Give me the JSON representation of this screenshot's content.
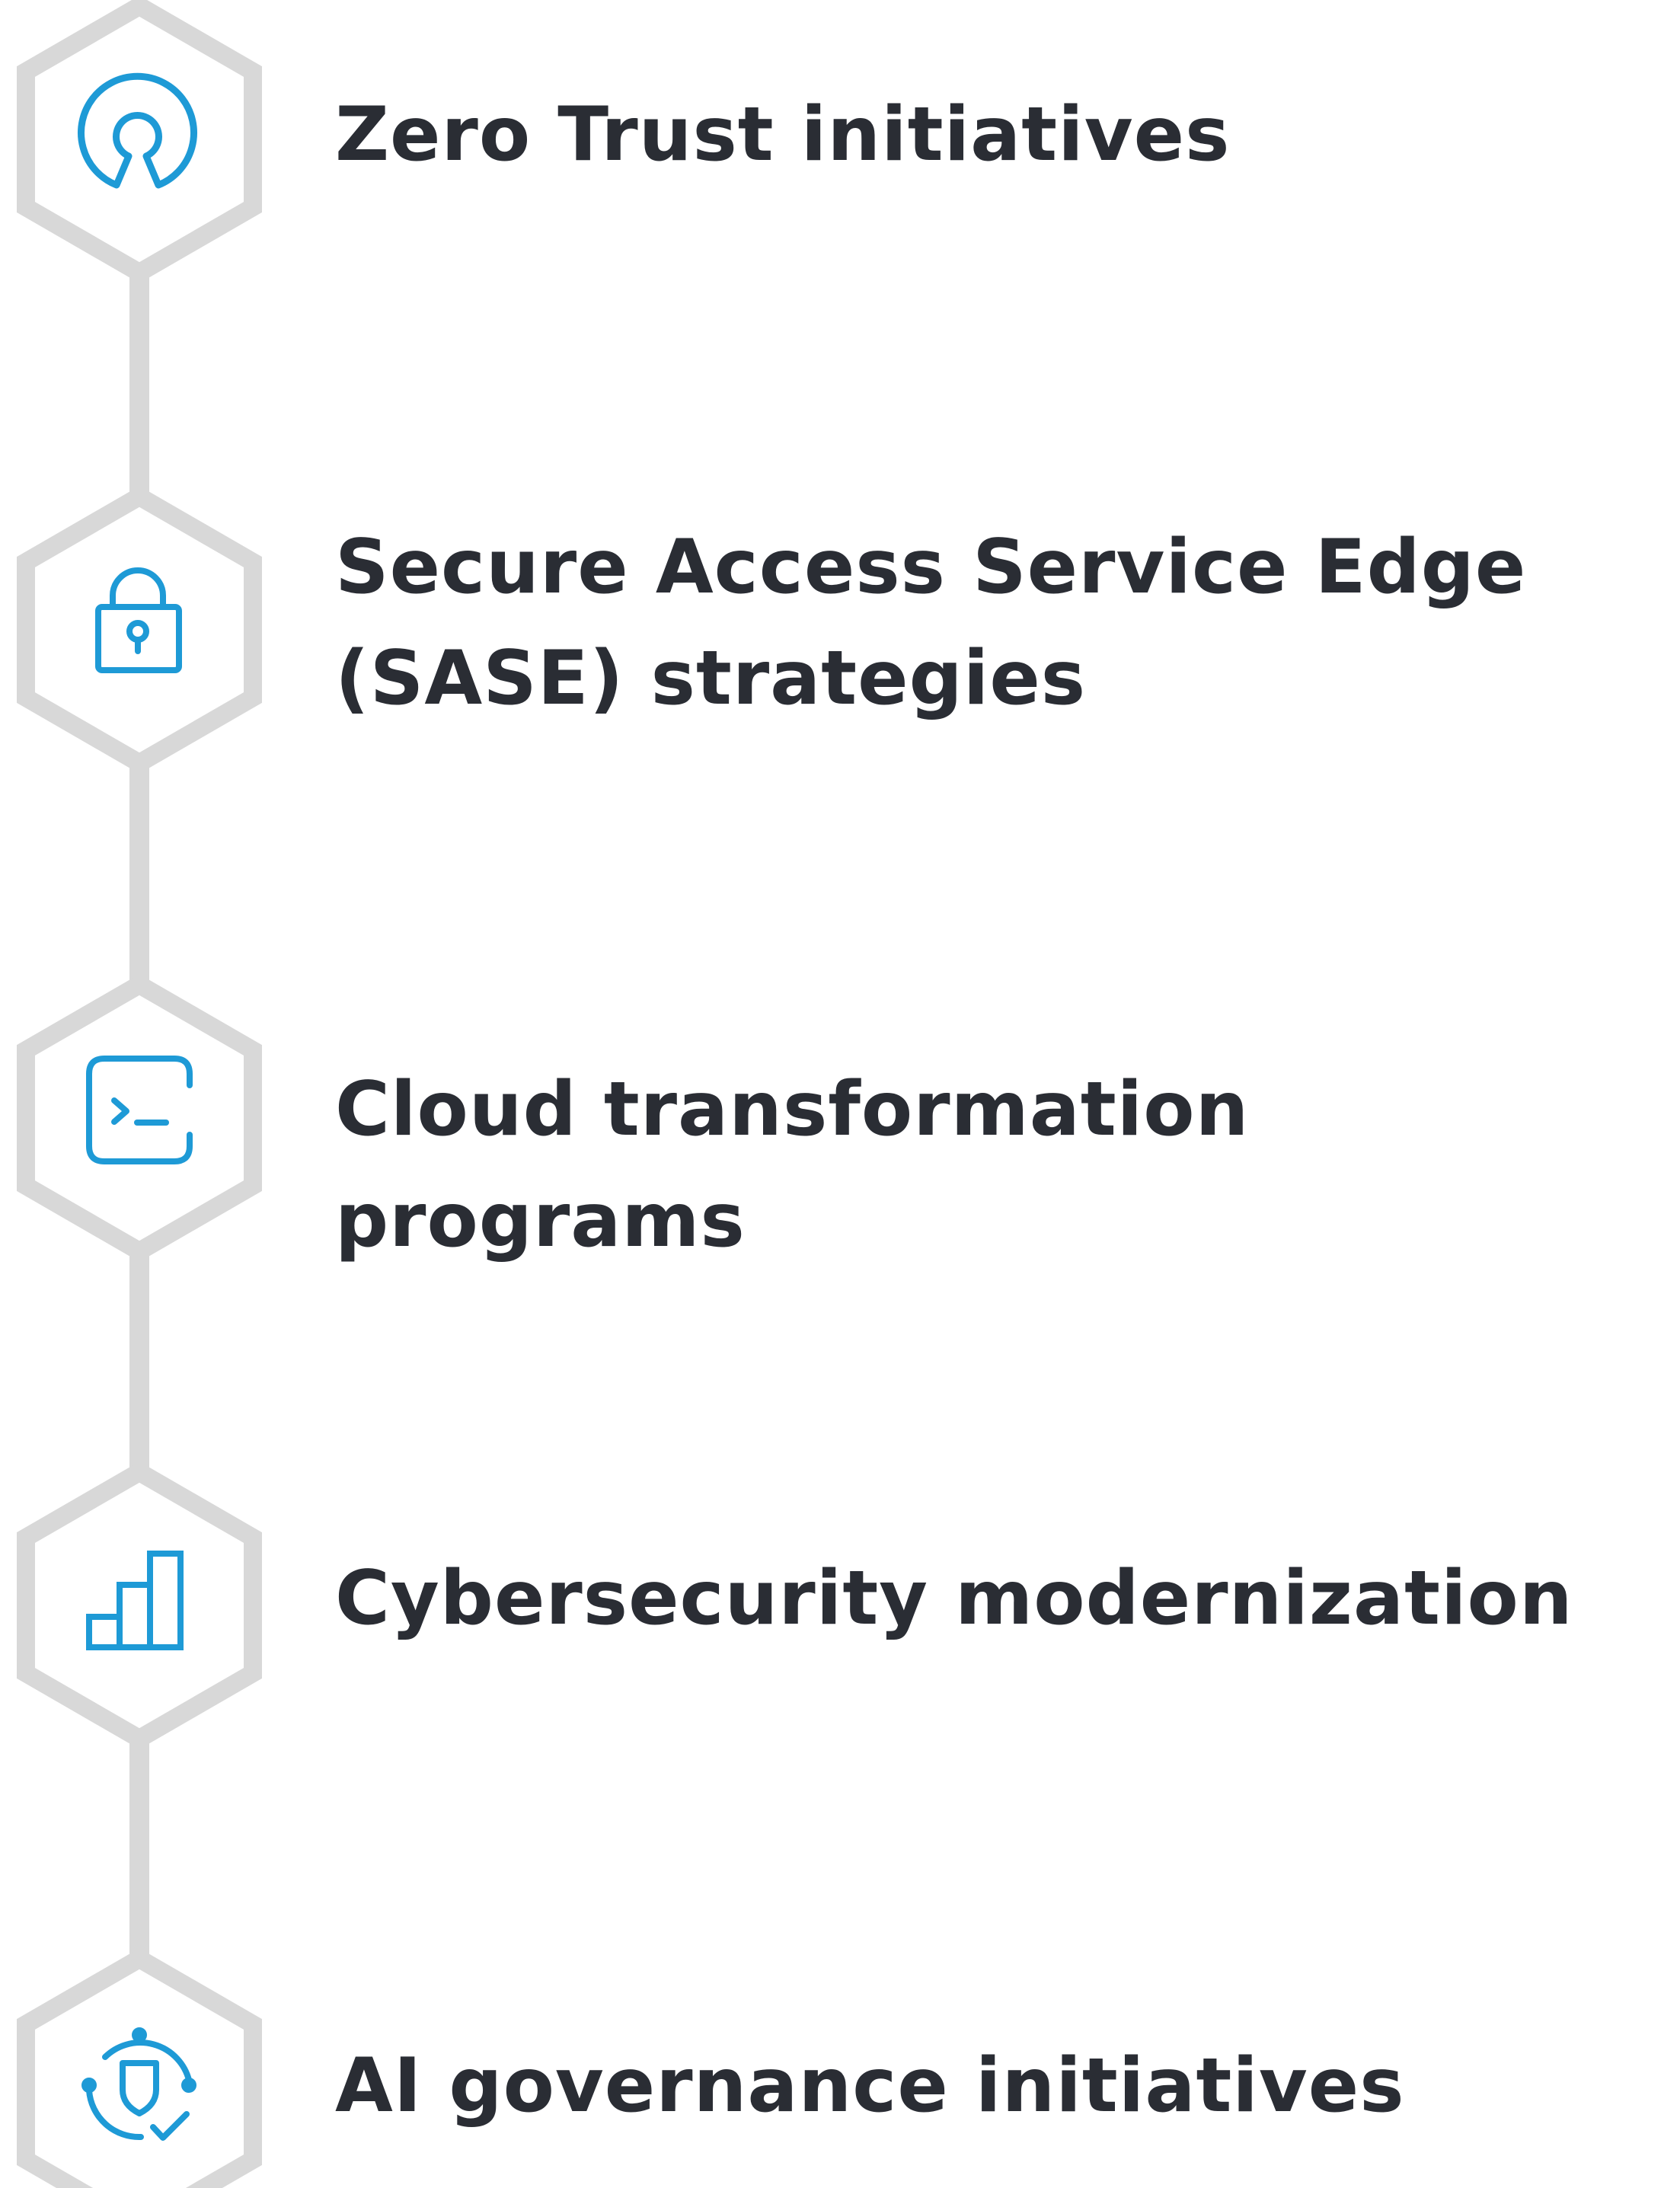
{
  "colors": {
    "connector": "#d8d8d8",
    "hexagon_stroke": "#d8d8d8",
    "icon": "#1e9ad6",
    "text": "#2a2d34",
    "background": "#ffffff"
  },
  "steps": [
    {
      "label": "Zero Trust initiatives",
      "icon": "open-source-icon"
    },
    {
      "label": "Secure Access Service Edge\n(SASE) strategies",
      "icon": "padlock-icon"
    },
    {
      "label": "Cloud transformation programs",
      "icon": "terminal-icon"
    },
    {
      "label": "Cybersecurity modernization",
      "icon": "bar-chart-icon"
    },
    {
      "label": "AI governance initiatives",
      "icon": "shield-check-icon"
    }
  ]
}
